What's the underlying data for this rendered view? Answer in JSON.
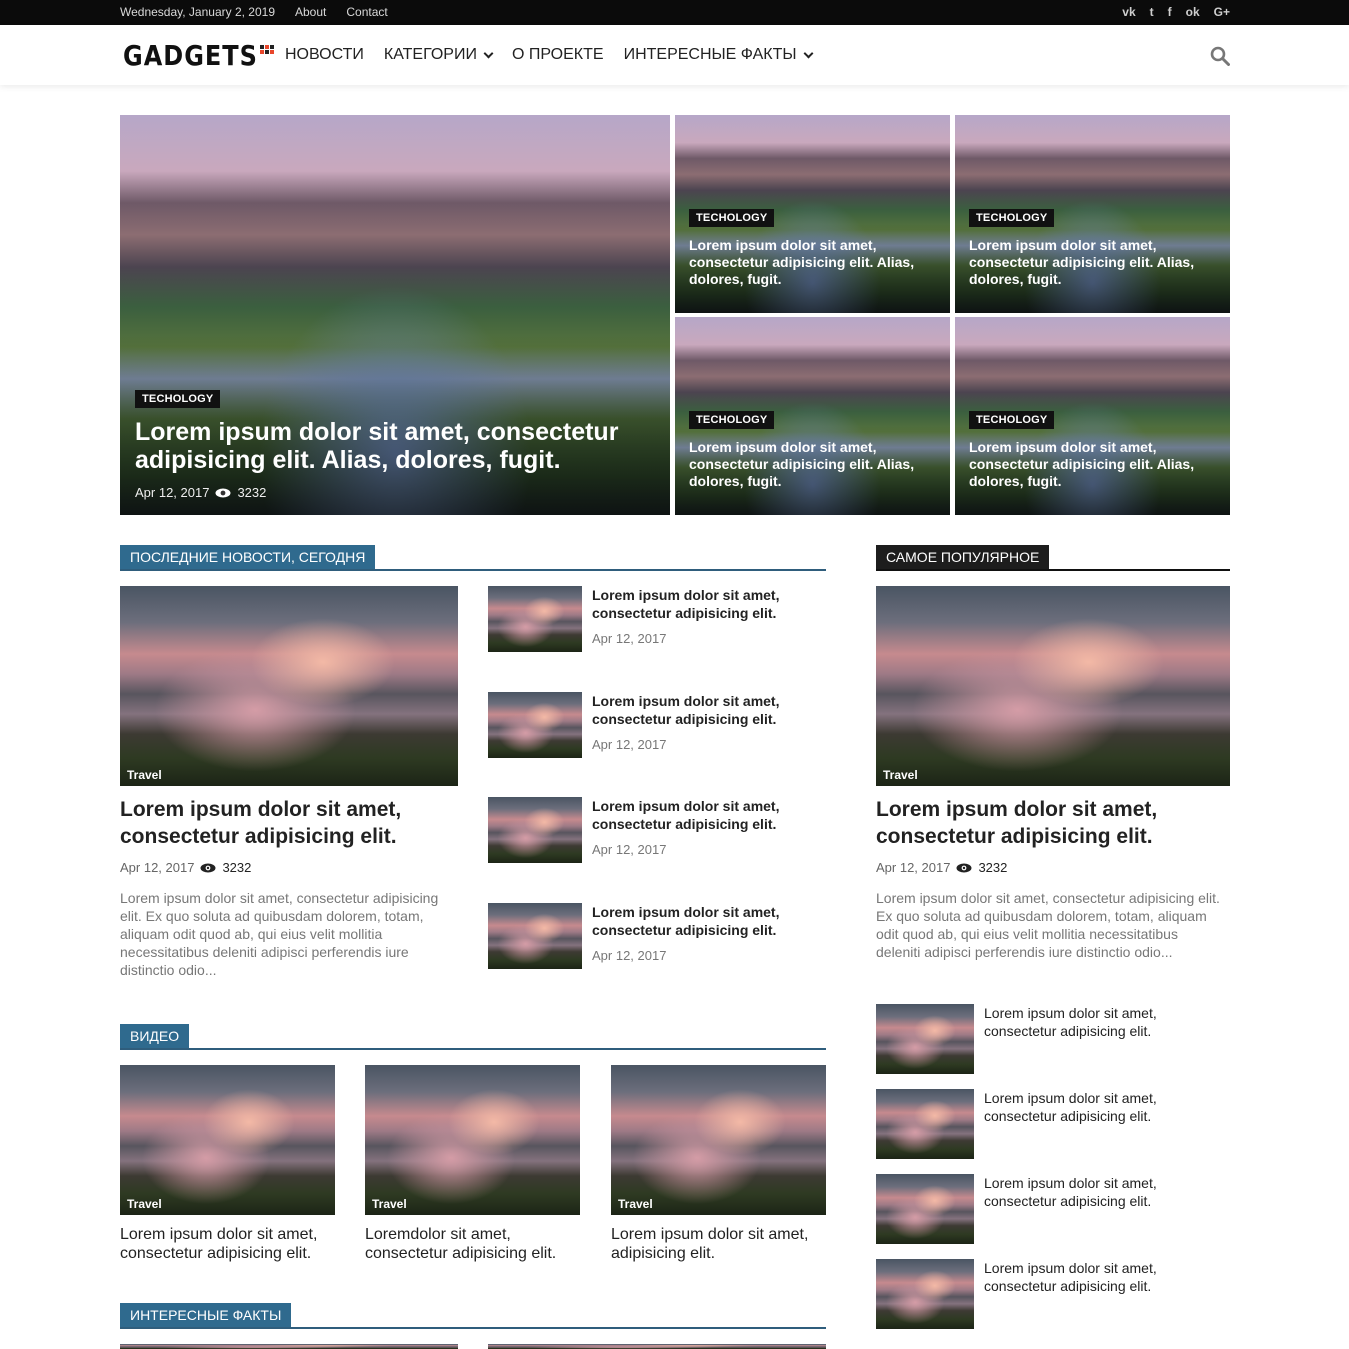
{
  "topbar": {
    "date": "Wednesday, January 2, 2019",
    "links": [
      "About",
      "Contact"
    ],
    "social": [
      "vk-icon",
      "twitter-icon",
      "facebook-icon",
      "odnoklassniki-icon",
      "google-plus-icon"
    ],
    "social_glyphs": [
      "vk",
      "t",
      "f",
      "ok",
      "G+"
    ]
  },
  "header": {
    "logo": "GADGETS",
    "nav": [
      "НОВОСТИ",
      "КАТЕГОРИИ",
      "О ПРОЕКТЕ",
      "ИНТЕРЕСНЫЕ ФАКТЫ"
    ]
  },
  "hero": {
    "main": {
      "tag": "TECHOLOGY",
      "title": "Lorem ipsum dolor sit amet, consectetur adipisicing elit. Alias, dolores, fugit.",
      "date": "Apr 12, 2017",
      "views": "3232"
    },
    "tiles": [
      {
        "tag": "TECHOLOGY",
        "title": "Lorem ipsum dolor sit amet, consectetur adipisicing elit. Alias, dolores, fugit."
      },
      {
        "tag": "TECHOLOGY",
        "title": "Lorem ipsum dolor sit amet, consectetur adipisicing elit. Alias, dolores, fugit."
      },
      {
        "tag": "TECHOLOGY",
        "title": "Lorem ipsum dolor sit amet, consectetur adipisicing elit. Alias, dolores, fugit."
      },
      {
        "tag": "TECHOLOGY",
        "title": "Lorem ipsum dolor sit amet, consectetur adipisicing elit. Alias, dolores, fugit."
      }
    ]
  },
  "latest": {
    "heading": "ПОСЛЕДНИЕ НОВОСТИ, СЕГОДНЯ",
    "featured": {
      "category": "Travel",
      "title": "Lorem ipsum dolor sit amet, consectetur adipisicing elit.",
      "date": "Apr 12, 2017",
      "views": "3232",
      "excerpt": "Lorem ipsum dolor sit amet, consectetur adipisicing elit. Ex quo soluta ad quibusdam dolorem, totam, aliquam odit quod ab, qui eius velit mollitia necessitatibus deleniti adipisci perferendis iure distinctio odio..."
    },
    "items": [
      {
        "title": "Lorem ipsum dolor sit amet, consectetur adipisicing elit.",
        "date": "Apr 12, 2017"
      },
      {
        "title": "Lorem ipsum dolor sit amet, consectetur adipisicing elit.",
        "date": "Apr 12, 2017"
      },
      {
        "title": "Lorem ipsum dolor sit amet, consectetur adipisicing elit.",
        "date": "Apr 12, 2017"
      },
      {
        "title": "Lorem ipsum dolor sit amet, consectetur adipisicing elit.",
        "date": "Apr 12, 2017"
      }
    ]
  },
  "video": {
    "heading": "ВИДЕО",
    "items": [
      {
        "category": "Travel",
        "title": "Lorem ipsum dolor sit amet, consectetur adipisicing elit."
      },
      {
        "category": "Travel",
        "title": "Loremdolor sit amet, consectetur adipisicing elit."
      },
      {
        "category": "Travel",
        "title": "Lorem ipsum dolor sit amet, adipisicing elit."
      }
    ]
  },
  "facts": {
    "heading": "ИНТЕРЕСНЫЕ ФАКТЫ"
  },
  "popular": {
    "heading": "САМОЕ ПОПУЛЯРНОЕ",
    "featured": {
      "category": "Travel",
      "title": "Lorem ipsum dolor sit amet, consectetur adipisicing elit.",
      "date": "Apr 12, 2017",
      "views": "3232",
      "excerpt": "Lorem ipsum dolor sit amet, consectetur adipisicing elit. Ex quo soluta ad quibusdam dolorem, totam, aliquam odit quod ab, qui eius velit mollitia necessitatibus deleniti adipisci perferendis iure distinctio odio..."
    },
    "items": [
      {
        "title": "Lorem ipsum dolor sit amet, consectetur adipisicing elit."
      },
      {
        "title": "Lorem ipsum dolor sit amet, consectetur adipisicing elit."
      },
      {
        "title": "Lorem ipsum dolor sit amet, consectetur adipisicing elit."
      },
      {
        "title": "Lorem ipsum dolor sit amet, consectetur adipisicing elit."
      }
    ]
  },
  "colors": {
    "accent": "#2f6a8e",
    "topbar": "#0b0b0b",
    "logo_accent": "#e8462b"
  }
}
